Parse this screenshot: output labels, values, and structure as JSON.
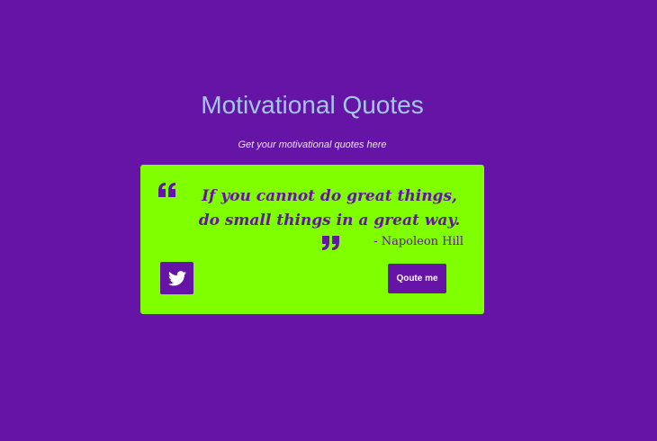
{
  "header": {
    "title": "Motivational Quotes",
    "subtitle": "Get your motivational quotes here"
  },
  "quote_card": {
    "text": "If you cannot do great things, do small things in a great way.",
    "author": "- Napoleon Hill",
    "background_color": "#80ff00",
    "accent_color": "#6514a5"
  },
  "actions": {
    "tweet_icon": "twitter-icon",
    "new_quote_label": "Qoute me"
  },
  "colors": {
    "page_background": "#6514a5",
    "title": "#a2c7e6",
    "subtitle": "#ece0f6"
  }
}
